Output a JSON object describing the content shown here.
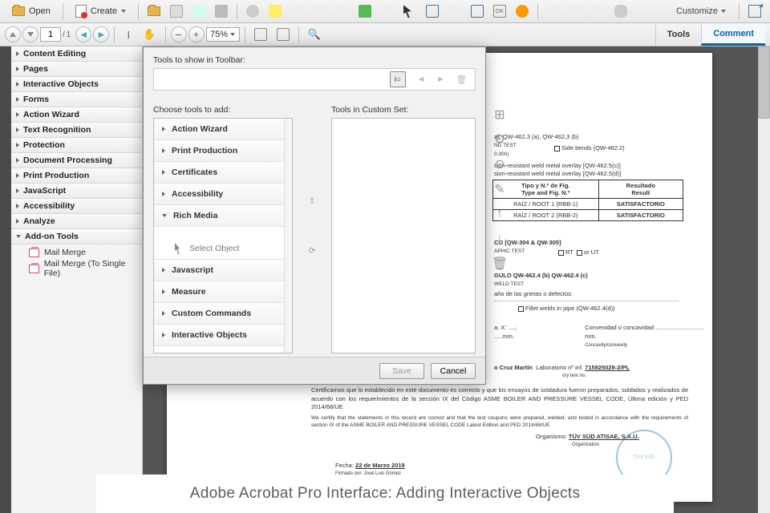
{
  "toolbar": {
    "open": "Open",
    "create": "Create",
    "customize": "Customize"
  },
  "nav": {
    "page_current": "1",
    "page_sep": "/",
    "page_total": "1",
    "zoom": "75%",
    "tools_tab": "Tools",
    "comment_tab": "Comment"
  },
  "panel": {
    "items": [
      "Content Editing",
      "Pages",
      "Interactive Objects",
      "Forms",
      "Action Wizard",
      "Text Recognition",
      "Protection",
      "Document Processing",
      "Print Production",
      "JavaScript",
      "Accessibility",
      "Analyze",
      "Add-on Tools"
    ],
    "addon_sub": [
      "Mail Merge",
      "Mail Merge (To Single File)"
    ]
  },
  "dialog": {
    "title": "Tools to show in Toolbar:",
    "choose_label": "Choose tools to add:",
    "custom_label": "Tools in Custom Set:",
    "accordion": [
      {
        "label": "Action Wizard",
        "bold": true
      },
      {
        "label": "Print Production",
        "bold": true
      },
      {
        "label": "Certificates",
        "bold": true
      },
      {
        "label": "Accessibility",
        "bold": true
      },
      {
        "label": "Rich Media",
        "bold": true
      }
    ],
    "select_object": "Select Object",
    "accordion2": [
      {
        "label": "Javascript",
        "bold": true
      },
      {
        "label": "Measure",
        "bold": true
      },
      {
        "label": "Custom Commands",
        "bold": true
      },
      {
        "label": "Interactive Objects",
        "bold": true
      }
    ],
    "save": "Save",
    "cancel": "Cancel"
  },
  "document": {
    "line1": "a), QW-462,3 (a), QW-462,3 (b)",
    "line2": "ND TEST",
    "side_bends": "Side bends (QW-462.2)",
    "overlay1": "sion-resistant weld metal overlay [QW-462.5(c)]",
    "overlay2": "sion-resistant weld metal overlay [QW-462.5(d)]",
    "th1": "Tipo y N.º de Fig.\nType and Fig. N.º",
    "th2": "Resultado\nResult",
    "r1a": "RAÍZ / ROOT 1 (RBB-1)",
    "r1b": "SATISFACTORIO",
    "r2a": "RAÍZ / ROOT 2 (RBB-2)",
    "r2b": "SATISFACTORIO",
    "qw304": "CO [QW-304 & QW-305]",
    "aphic": "APHIC TEST",
    "rt": "RT",
    "ut": "or UT",
    "qw462_4": "GULO QW-462.4 (b) QW-462.4 (c)",
    "weld_test": "WELD TEST",
    "grietas": "año de las grietas o defectos:",
    "fillet": "Fillet welds in pipe (QW-462.4(d))",
    "convex": "Convexidad o concavidad",
    "convex_en": "Concavity/convexity",
    "mm": "mm.",
    "dotsA": "a. X: ....; .....mm.",
    "cruz": "o Cruz Martín",
    "lab": "Laboratorio nº inf.",
    "labno": "715825028-2/PL",
    "labtest": "ory test no.",
    "cert_es": "Certificamos que lo establecido en este documento es correcto y que los ensayos de soldadura fueron preparados, soldados y realizados de acuerdo con los requerimientos de la sección IX del Código ASME BOILER AND PRESSURE VESSEL CODE, Última edición y PED 2014/68/UE",
    "cert_en": "We certify that the statements in this record are correct and that the test coupons were prepared, welded, and tested in accordance with the requirements of section IX of the ASME BOILER AND PRESSURE VESSEL CODE Latest Edition and PED 2014/68/UE",
    "org": "Organismo:",
    "org_name": "TÜV SÜD ATISAE, S.A.U.",
    "org_en": "Organization",
    "fecha": "Fecha:",
    "fecha_val": "22 de Marzo 2019",
    "signed": "Firmado por: José Luis Gómez"
  },
  "caption": "Adobe Acrobat Pro Interface: Adding Interactive Objects"
}
